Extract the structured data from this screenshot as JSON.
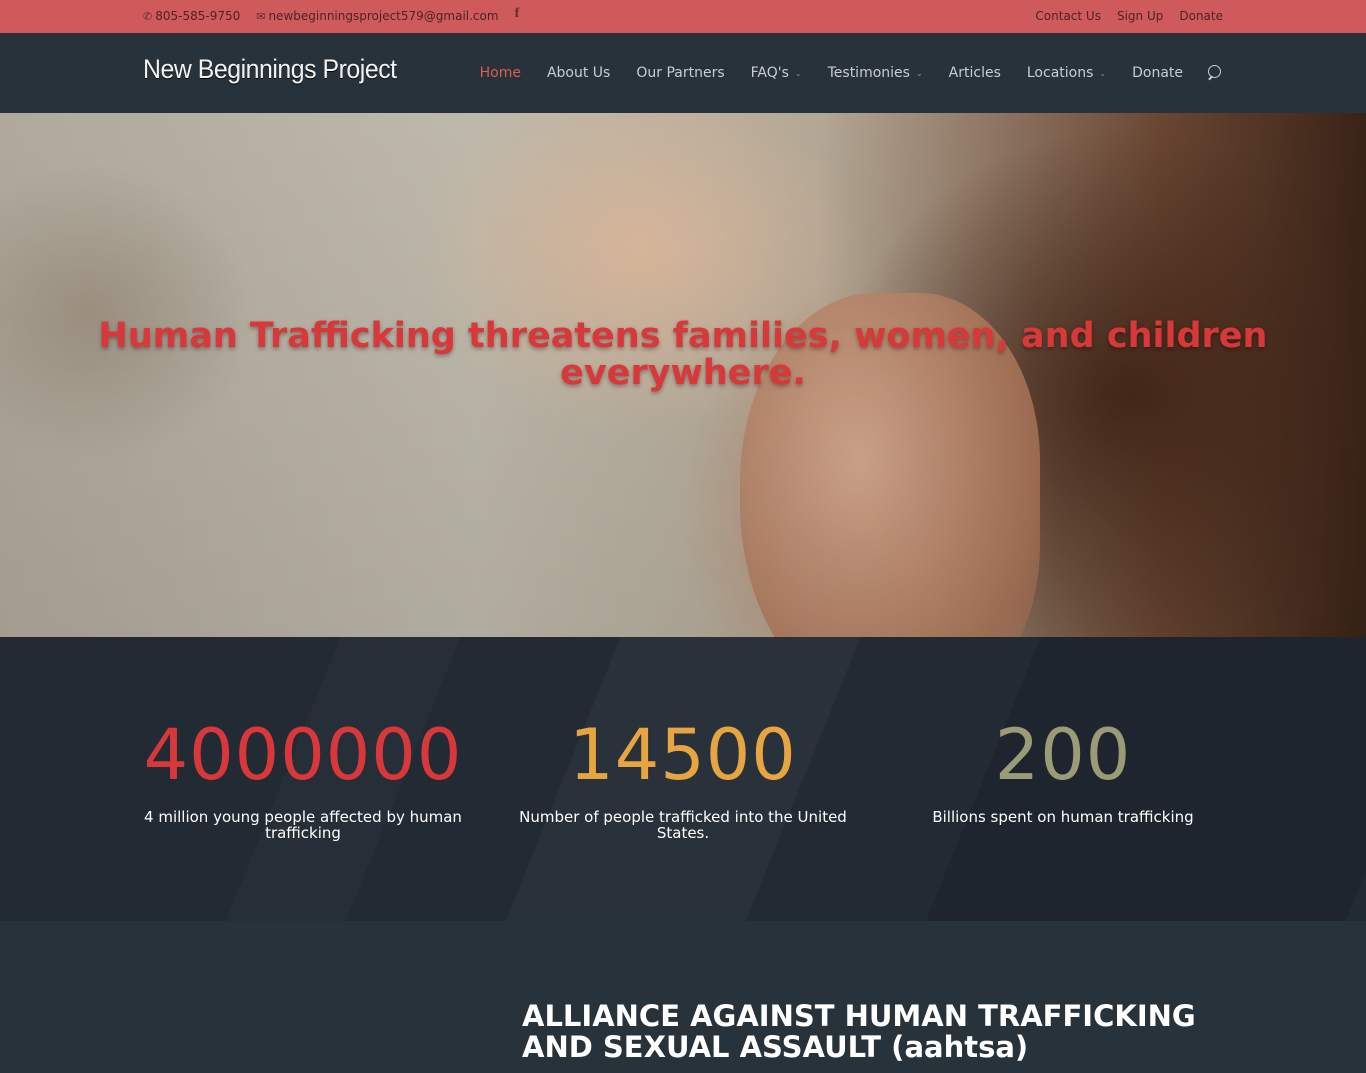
{
  "top_bar": {
    "phone": "805-585-9750",
    "email": "newbeginningsproject579@gmail.com",
    "links": [
      "Contact Us",
      "Sign Up",
      "Donate"
    ],
    "colors": {
      "background": "#cf5a5c"
    }
  },
  "header": {
    "logo": "New Beginnings Project",
    "nav": [
      {
        "label": "Home",
        "active": true
      },
      {
        "label": "About Us"
      },
      {
        "label": "Our Partners"
      },
      {
        "label": "FAQ's",
        "dropdown": true
      },
      {
        "label": "Testimonies",
        "dropdown": true
      },
      {
        "label": "Articles"
      },
      {
        "label": "Locations",
        "dropdown": true
      },
      {
        "label": "Donate"
      }
    ],
    "colors": {
      "active": "#e05a56",
      "background": "#27323b"
    }
  },
  "hero": {
    "title": "Human Trafficking threatens families, women, and children everywhere.",
    "colors": {
      "title": "#d9383a"
    }
  },
  "stats": [
    {
      "number": "4000000",
      "description": "4 million young people affected by human trafficking",
      "color": "#d9383a"
    },
    {
      "number": "14500",
      "description": "Number of people trafficked into the United States.",
      "color": "#e6a541"
    },
    {
      "number": "200",
      "description": "Billions spent on human trafficking",
      "color": "#9a9b77"
    }
  ],
  "section": {
    "title": "ALLIANCE AGAINST HUMAN TRAFFICKING AND SEXUAL ASSAULT (aahtsa)"
  },
  "icons": [
    "phone-icon",
    "email-icon",
    "facebook-icon",
    "chevron-down-icon",
    "search-icon"
  ]
}
